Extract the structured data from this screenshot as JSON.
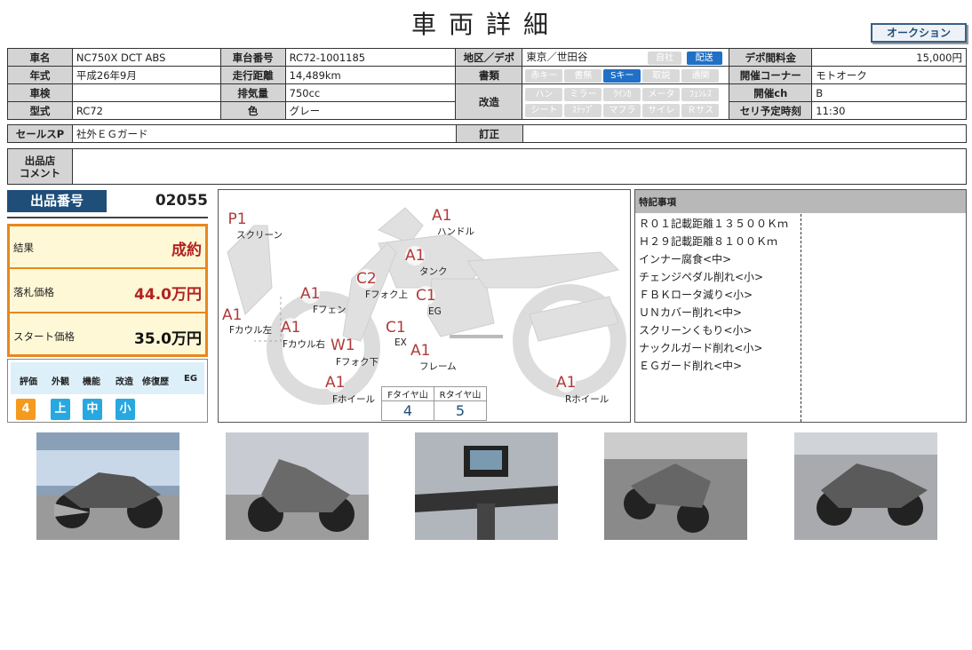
{
  "title": "車両詳細",
  "auction_label": "オークション",
  "vehicle": {
    "name_h": "車名",
    "name": "NC750X DCT ABS",
    "chassis_h": "車台番号",
    "chassis": "RC72-1001185",
    "region_h": "地区／デポ",
    "region": "東京／世田谷",
    "region_pills": [
      "自社",
      "配送"
    ],
    "fee_h": "デポ間料金",
    "fee": "15,000円",
    "year_h": "年式",
    "year": "平成26年9月",
    "mileage_h": "走行距離",
    "mileage": "14,489km",
    "docs_h": "書類",
    "docs_pills": [
      "赤キー",
      "書無",
      "Sキー",
      "取説",
      "通関"
    ],
    "corner_h": "開催コーナー",
    "corner": "モトオーク",
    "inspection_h": "車検",
    "inspection": "",
    "displacement_h": "排気量",
    "displacement": "750cc",
    "mod_h": "改造",
    "mod_pills_1": [
      "ハン",
      "ミラー",
      "ｳｲﾝｶ",
      "メータ",
      "ﾌｪﾝﾚｽ"
    ],
    "mod_pills_2": [
      "シート",
      "ｽﾃｯﾌﾟ",
      "マフラ",
      "サイレ",
      "Ｒサス"
    ],
    "ch_h": "開催ch",
    "ch": "B",
    "model_h": "型式",
    "model": "RC72",
    "color_h": "色",
    "color": "グレー",
    "time_h": "セリ予定時刻",
    "time": "11:30",
    "sales_h": "セールスP",
    "sales": "社外ＥＧガード",
    "correction_h": "訂正",
    "correction": "",
    "comment_h1": "出品店",
    "comment_h2": "コメント",
    "comment": ""
  },
  "lot": {
    "label": "出品番号",
    "number": "02055"
  },
  "result": {
    "result_label": "結果",
    "result_value": "成約",
    "bid_label": "落札価格",
    "bid_value": "44.0万円",
    "start_label": "スタート価格",
    "start_value": "35.0万円"
  },
  "evaluation": {
    "headers": [
      "評価",
      "外観",
      "機能",
      "改造",
      "修復歴",
      "EG"
    ],
    "values": [
      "4",
      "上",
      "中",
      "小"
    ],
    "colors": [
      "#f59a1e",
      "#27a8e0",
      "#27a8e0",
      "#27a8e0"
    ]
  },
  "diagram": {
    "marks": [
      {
        "code": "P1",
        "label": "スクリーン"
      },
      {
        "code": "A1",
        "label": "ハンドル"
      },
      {
        "code": "A1",
        "label": "タンク"
      },
      {
        "code": "C2",
        "label": "Fフォク上"
      },
      {
        "code": "C1",
        "label": "EG"
      },
      {
        "code": "A1",
        "label": "Fフェン"
      },
      {
        "code": "A1",
        "label": "Fカウル左"
      },
      {
        "code": "A1",
        "label": "Fカウル右"
      },
      {
        "code": "W1",
        "label": "Fフォク下"
      },
      {
        "code": "C1",
        "label": "EX"
      },
      {
        "code": "A1",
        "label": "フレーム"
      },
      {
        "code": "A1",
        "label": "Fホイール"
      },
      {
        "code": "A1",
        "label": "Rホイール"
      }
    ],
    "tire_front_label": "Fタイヤ山",
    "tire_front": "4",
    "tire_rear_label": "Rタイヤ山",
    "tire_rear": "5"
  },
  "notes": {
    "header": "特記事項",
    "lines": [
      "Ｒ０１記載距離１３５００Ｋｍ",
      "Ｈ２９記載距離８１００Ｋｍ",
      "インナー腐食<中>",
      "チェンジペダル削れ<小>",
      "ＦＢＫロータ減り<小>",
      "ＵＮカバー削れ<中>",
      "スクリーンくもり<小>",
      "ナックルガード削れ<小>",
      "ＥＧガード削れ<中>"
    ]
  }
}
